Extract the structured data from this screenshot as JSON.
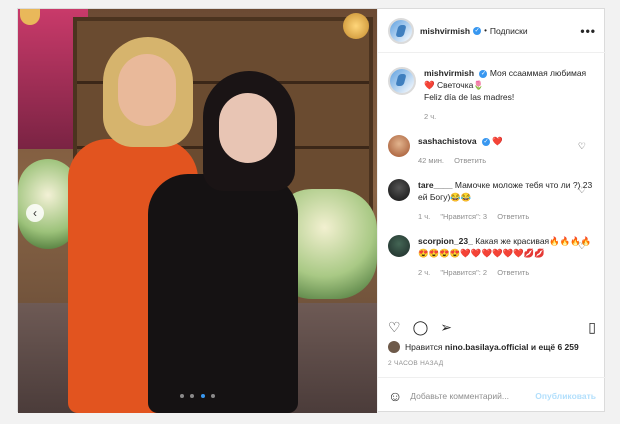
{
  "post": {
    "username": "mishvirmish",
    "verified_icon": "verified-badge-icon",
    "separator": "•",
    "follow_label": "Подписки",
    "more_label": "•••"
  },
  "caption": {
    "username": "mishvirmish",
    "line1": "Моя ссааммая любимая❤️ Светочка🌷",
    "line2": "Feliz día de las madres!",
    "time": "2 ч."
  },
  "comments": [
    {
      "username": "sashachistova",
      "text": "❤️",
      "time": "42 мин.",
      "reply": "Ответить"
    },
    {
      "username": "tare____",
      "text": "Мамочке моложе тебя что ли ?) 23 ей Богу)😂😂",
      "time": "1 ч.",
      "likes": "\"Нравится\": 3",
      "reply": "Ответить"
    },
    {
      "username": "scorpion_23_",
      "text": "Какая же красивая🔥🔥🔥🔥😍😍😍😍❤️❤️❤️❤️❤️❤️💋💋",
      "time": "2 ч.",
      "likes": "\"Нравится\": 2",
      "reply": "Ответить"
    }
  ],
  "likes": {
    "prefix": "Нравится",
    "user": "nino.basilaya.official",
    "suffix": "и ещё 6 259"
  },
  "timeago": "2 ЧАСОВ НАЗАД",
  "comment_box": {
    "placeholder": "Добавьте комментарий...",
    "publish_label": "Опубликовать"
  },
  "colors": {
    "accent": "#3897f0",
    "publish_disabled": "#b2dffc",
    "muted": "#8e8e8e"
  }
}
